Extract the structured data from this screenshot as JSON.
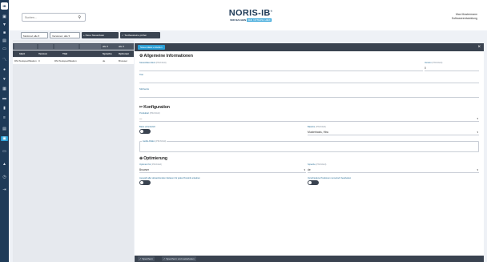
{
  "rail": {
    "logo": "IB",
    "icons": [
      "logo-icon",
      "dashboard-icon",
      "funnel-icon",
      "folder-icon",
      "box-icon",
      "chart-icon",
      "settings-icon",
      "cart-icon",
      "grid-icon",
      "document-icon",
      "info-icon",
      "list-icon",
      "id-card-icon",
      "folder-open-icon",
      "lock-icon",
      "clock-icon",
      "logout-icon"
    ],
    "active_index": 13
  },
  "header": {
    "search_placeholder": "Suchen...",
    "brand_name": "NORIS-IB",
    "brand_mark": "®",
    "brand_tag_prefix": "WIR MACHEN",
    "brand_tag_highlight": "DEN UNTERSCHIED",
    "user_name": "Max Mustermann",
    "user_role": "Softwareentwicklung"
  },
  "toolbar": {
    "filter1": "Merkmal: alle",
    "filter2": "Versionen: alle",
    "new_button": "+ Neue Steuerdatei",
    "check_button": "Textbausteine prüfen"
  },
  "table": {
    "filter_values": [
      "",
      "",
      "",
      "",
      "alle",
      "alle"
    ],
    "headers": [
      "Ident",
      "Version",
      "Titel",
      "Sprache",
      "Optionen"
    ],
    "rows": [
      [
        "DM-Testspezifikation",
        "0",
        "DM-Testspezifikation",
        "de",
        "Browser"
      ]
    ]
  },
  "modal": {
    "header_tag": "Steuerdatei erstellen",
    "close": "×",
    "section1": "Allgemeine Informationen",
    "fields": {
      "ident": {
        "label": "Steuerdatei-Ident",
        "optional": "(Pflichtfeld)",
        "value": ""
      },
      "version": {
        "label": "Version",
        "optional": "(Pflichtfeld)",
        "value": "0"
      },
      "titel": {
        "label": "Titel",
        "optional": "",
        "value": ""
      },
      "stichworte": {
        "label": "Stichworte",
        "optional": "",
        "value": ""
      }
    },
    "section2": "Konfiguration",
    "config": {
      "produktart": {
        "label": "Produktart",
        "optional": "(Pflichtfeld)",
        "value": "—"
      },
      "basis_label": "Basis erforderlich",
      "basis_toggle": false,
      "bashe": {
        "label": "Basishe",
        "optional": "(Pflichtfeld)",
        "value": "Musterbasis, Hkw"
      },
      "audits": {
        "label": "Audits-Rollen",
        "optional": "(Pflichtfeld)",
        "value": ""
      }
    },
    "section3": "Optimierung",
    "optim": {
      "optimiert_fuer": {
        "label": "Optimiert für",
        "optional": "(Pflichtfeld)",
        "value": "Browser"
      },
      "sprache": {
        "label": "Sprache",
        "optional": "(Pflichtfeld)",
        "value": "de"
      },
      "toggle1_label": "Auswahl aller abweichenden Zeilanen für jedes Preisinfo erlauben",
      "toggle1": false,
      "toggle2_label": "Verschiedene Positionen numerisch bearbeiten",
      "toggle2": false
    }
  },
  "footer": {
    "save": "Speichern",
    "save_and_continue": "Speichern und weiterleiten"
  }
}
